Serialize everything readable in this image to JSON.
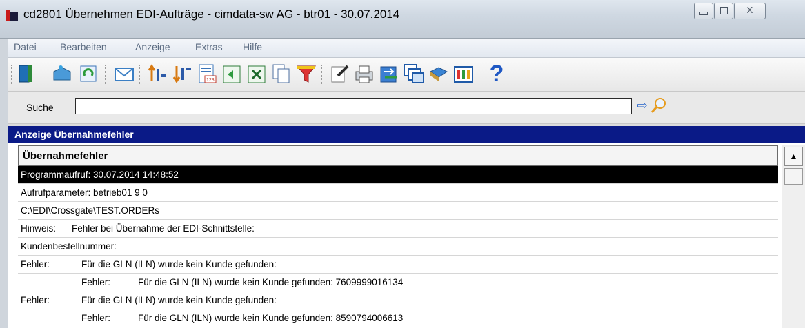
{
  "window": {
    "title": "cd2801 Übernehmen EDI-Aufträge - cimdata-sw AG - btr01 - 30.07.2014",
    "close_glyph": "X"
  },
  "menu": [
    "Datei",
    "Bearbeiten",
    "Anzeige",
    "Extras",
    "Hilfe"
  ],
  "toolbar_icons": [
    "exit-door-icon",
    "open-folder-icon",
    "refresh-icon",
    "envelope-icon",
    "sort-ascending-icon",
    "sort-descending-icon",
    "number-list-icon",
    "export-green-icon",
    "excel-icon",
    "copy-document-icon",
    "filter-funnel-icon",
    "edit-document-icon",
    "print-icon",
    "transfer-arrows-icon",
    "windows-icon",
    "bookmark-icon",
    "grid-icon",
    "help-icon"
  ],
  "toolbar_help_label": "?",
  "search": {
    "label": "Suche",
    "value": "",
    "arrow_glyph": "⇨"
  },
  "section": {
    "title": "Anzeige Übernahmefehler"
  },
  "table": {
    "column": "Übernahmefehler",
    "rows": [
      {
        "a": "Programmaufruf:  30.07.2014 14:48:52",
        "b": "",
        "c": "",
        "selected": true
      },
      {
        "a": "Aufrufparameter: betrieb01 9 0",
        "b": "",
        "c": ""
      },
      {
        "a": "C:\\EDI\\Crossgate\\TEST.ORDERs",
        "b": "",
        "c": ""
      },
      {
        "a": "Hinweis:",
        "b": "Fehler bei Übernahme der EDI-Schnittstelle:",
        "c": ""
      },
      {
        "a": "Kundenbestellnummer:",
        "b": "",
        "c": ""
      },
      {
        "a": "Fehler:",
        "b": "Für die GLN (ILN) wurde kein Kunde gefunden:",
        "c": ""
      },
      {
        "a": "",
        "b": "Fehler:",
        "c": "Für die GLN (ILN) wurde kein Kunde gefunden: 7609999016134"
      },
      {
        "a": "Fehler:",
        "b": "Für die GLN (ILN) wurde kein Kunde gefunden:",
        "c": ""
      },
      {
        "a": "",
        "b": "Fehler:",
        "c": "Für die GLN (ILN) wurde kein Kunde gefunden: 8590794006613"
      }
    ]
  },
  "scrollbar": {
    "up_glyph": "▲"
  },
  "colors": {
    "section_header_bg": "#0a1a87",
    "selected_row_bg": "#000000",
    "menu_text": "#5a6a80"
  }
}
